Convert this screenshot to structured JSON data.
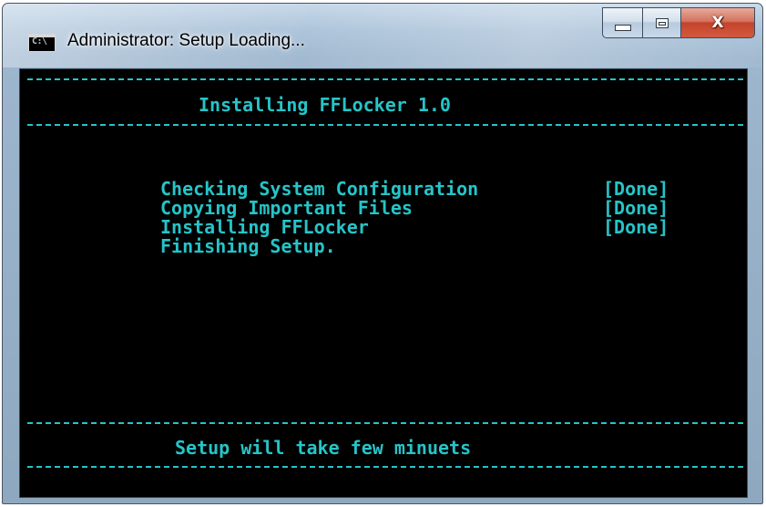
{
  "window": {
    "title": "Administrator: Setup Loading...",
    "icon_name": "cmd-icon",
    "icon_text": "C:\\",
    "buttons": {
      "minimize": "minimize-icon",
      "maximize": "maximize-icon",
      "close": "close-icon",
      "close_glyph": "X"
    }
  },
  "console": {
    "heading": "Installing FFLocker 1.0",
    "steps": [
      {
        "label": "Checking System Configuration",
        "status": "[Done]"
      },
      {
        "label": "Copying Important Files",
        "status": "[Done]"
      },
      {
        "label": "Installing FFLocker",
        "status": "[Done]"
      },
      {
        "label": "Finishing Setup.",
        "status": ""
      }
    ],
    "footer": "Setup will take few minuets",
    "colors": {
      "background": "#000000",
      "text": "#26c4c8"
    }
  }
}
